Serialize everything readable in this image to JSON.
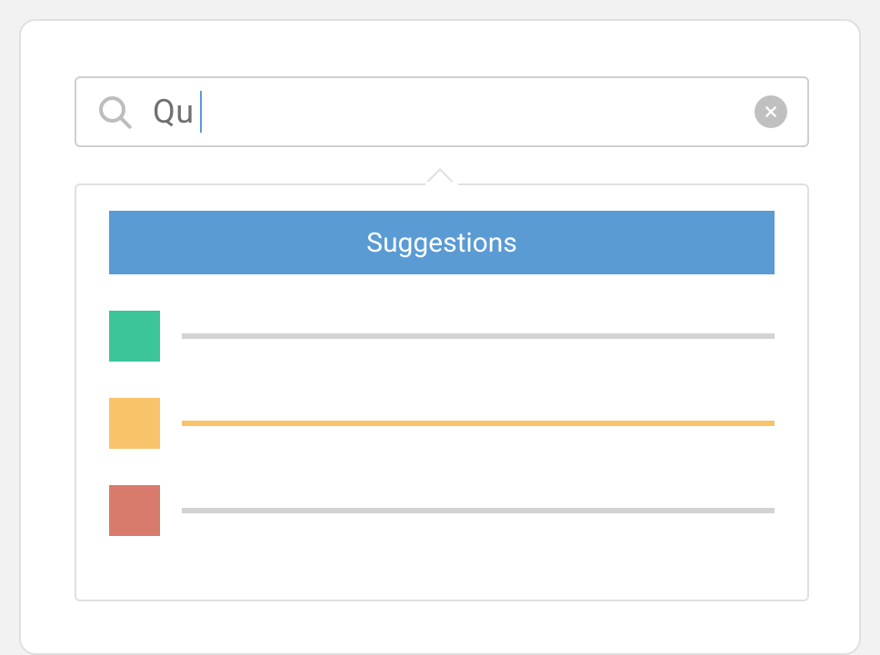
{
  "search": {
    "value": "Qu",
    "icon_name": "search-icon",
    "clear_icon_name": "close-icon"
  },
  "dropdown": {
    "header_label": "Suggestions",
    "items": [
      {
        "swatch_color": "#3cc49a",
        "line_color": "#d3d3d3"
      },
      {
        "swatch_color": "#f8c36b",
        "line_color": "#f8c36b"
      },
      {
        "swatch_color": "#d97b6c",
        "line_color": "#d3d3d3"
      }
    ]
  },
  "colors": {
    "accent": "#5a9bd4",
    "panel_border": "#e0e0e0",
    "search_border": "#cfcfcf",
    "icon_muted": "#bdbdbd",
    "text_muted": "#707070",
    "clear_bg": "#c0c0c0",
    "background": "#f2f2f2"
  }
}
